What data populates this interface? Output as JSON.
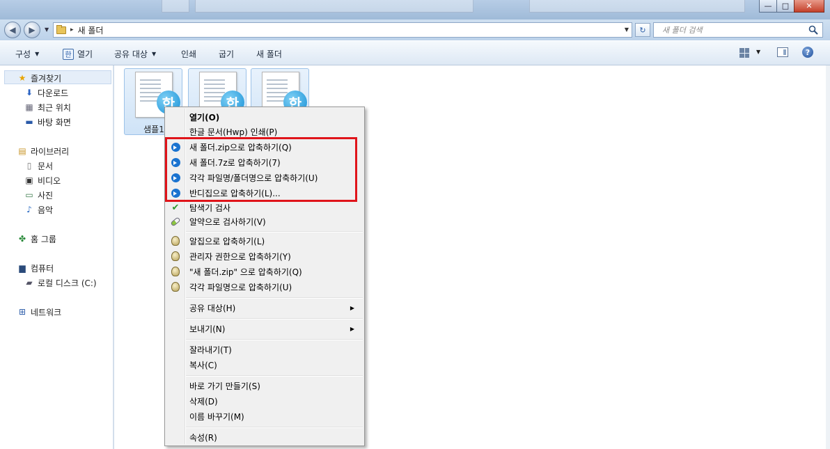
{
  "window": {
    "controls": {
      "minimize": "—",
      "maximize": "□",
      "close": "✕"
    }
  },
  "address": {
    "path_separator": "▸",
    "folder_name": "새 폴더",
    "search_placeholder": "새 폴더 검색"
  },
  "toolbar": {
    "organize": "구성",
    "open": "열기",
    "share": "공유 대상",
    "print": "인쇄",
    "burn": "굽기",
    "new_folder": "새 폴더",
    "help": "?"
  },
  "sidebar": {
    "favorites": "즐겨찾기",
    "downloads": "다운로드",
    "recent": "최근 위치",
    "desktop": "바탕 화면",
    "libraries": "라이브러리",
    "documents": "문서",
    "videos": "비디오",
    "pictures": "사진",
    "music": "음악",
    "homegroup": "홈 그룹",
    "computer": "컴퓨터",
    "local_disk": "로컬 디스크 (C:)",
    "network": "네트워크"
  },
  "files": [
    {
      "label": "샘플1",
      "badge": "한"
    },
    {
      "label": "",
      "badge": "한"
    },
    {
      "label": "",
      "badge": "한"
    }
  ],
  "context_menu": {
    "open": "열기(O)",
    "print_hwp": "한글 문서(Hwp) 인쇄(P)",
    "bandizip_zip": "새 폴더.zip으로 압축하기(Q)",
    "bandizip_7z": "새 폴더.7z로 압축하기(7)",
    "bandizip_each": "각각 파일명/폴더명으로 압축하기(U)",
    "bandizip_dialog": "반디집으로 압축하기(L)...",
    "explorer_scan": "탐색기 검사",
    "alyac_scan": "알약으로 검사하기(V)",
    "alzip_compress": "알집으로 압축하기(L)",
    "alzip_admin": "관리자 권한으로 압축하기(Y)",
    "alzip_zip": "\"새 폴더.zip\" 으로 압축하기(Q)",
    "alzip_each": "각각 파일명으로 압축하기(U)",
    "share_with": "공유 대상(H)",
    "send_to": "보내기(N)",
    "cut": "잘라내기(T)",
    "copy": "복사(C)",
    "create_shortcut": "바로 가기 만들기(S)",
    "delete": "삭제(D)",
    "rename": "이름 바꾸기(M)",
    "properties": "속성(R)"
  },
  "colors": {
    "highlight_box": "#e0141a",
    "bandizip_blue": "#1a73d0"
  }
}
